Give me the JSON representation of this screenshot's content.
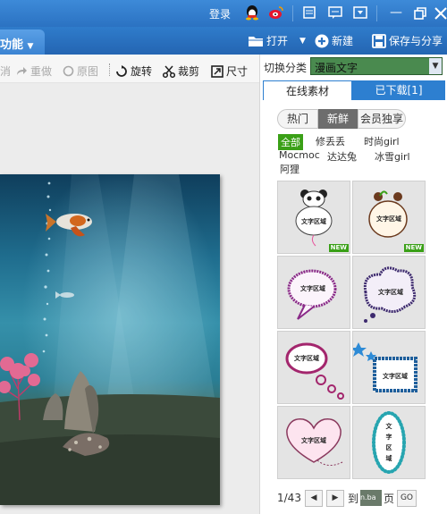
{
  "topbar": {
    "login_label": "登录",
    "icons": [
      "qq-icon",
      "weibo-icon",
      "document-icon",
      "chat-icon",
      "dropdown-box-icon"
    ],
    "window_controls": [
      "minimize-icon",
      "restore-icon",
      "close-icon"
    ]
  },
  "toolbar": {
    "func_label": "功能",
    "open_label": "打开",
    "new_label": "新建",
    "save_share_label": "保存与分享"
  },
  "edit_toolbar": {
    "undo_label": "消",
    "redo_label": "重做",
    "original_label": "原图",
    "rotate_label": "旋转",
    "crop_label": "裁剪",
    "size_label": "尺寸"
  },
  "right_panel": {
    "category_label": "切换分类",
    "category_value": "漫画文字",
    "tab_online": "在线素材",
    "tab_downloaded": "已下载[1]",
    "segments": [
      "热门",
      "新鲜",
      "会员独享"
    ],
    "active_segment": "新鲜",
    "tags": [
      "全部",
      "修丢丢",
      "时尚girl",
      "Mocmoc",
      "达达兔",
      "冰雪girl",
      "阿狸"
    ],
    "active_tag": "全部",
    "material_label": "文字区域",
    "new_badge": "NEW",
    "pager": {
      "page_info": "1/43",
      "goto_label": "到",
      "goto_value": "n.ba",
      "page_suffix": "页",
      "go_label": "GO"
    }
  },
  "colors": {
    "title_blue": "#2b72c2",
    "new_green": "#3aa017",
    "category_green": "#4a8a4f"
  }
}
